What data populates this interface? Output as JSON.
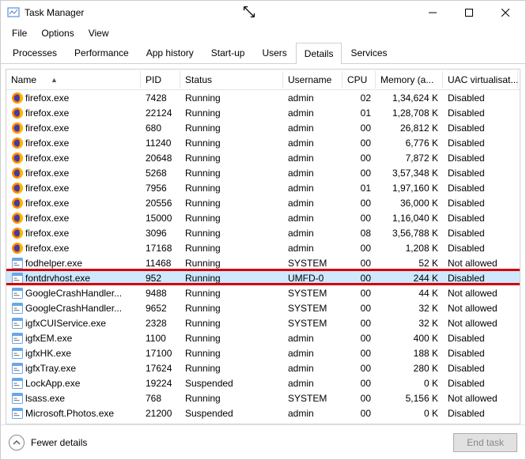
{
  "window": {
    "title": "Task Manager"
  },
  "menu": {
    "file": "File",
    "options": "Options",
    "view": "View"
  },
  "tabs": {
    "processes": "Processes",
    "performance": "Performance",
    "app_history": "App history",
    "startup": "Start-up",
    "users": "Users",
    "details": "Details",
    "services": "Services"
  },
  "columns": {
    "name": "Name",
    "pid": "PID",
    "status": "Status",
    "username": "Username",
    "cpu": "CPU",
    "memory": "Memory (a...",
    "uac": "UAC virtualisat..."
  },
  "footer": {
    "fewer": "Fewer details",
    "end": "End task"
  },
  "rows": [
    {
      "icon": "firefox",
      "name": "firefox.exe",
      "pid": "7428",
      "status": "Running",
      "user": "admin",
      "cpu": "02",
      "mem": "1,34,624 K",
      "uac": "Disabled"
    },
    {
      "icon": "firefox",
      "name": "firefox.exe",
      "pid": "22124",
      "status": "Running",
      "user": "admin",
      "cpu": "01",
      "mem": "1,28,708 K",
      "uac": "Disabled"
    },
    {
      "icon": "firefox",
      "name": "firefox.exe",
      "pid": "680",
      "status": "Running",
      "user": "admin",
      "cpu": "00",
      "mem": "26,812 K",
      "uac": "Disabled"
    },
    {
      "icon": "firefox",
      "name": "firefox.exe",
      "pid": "11240",
      "status": "Running",
      "user": "admin",
      "cpu": "00",
      "mem": "6,776 K",
      "uac": "Disabled"
    },
    {
      "icon": "firefox",
      "name": "firefox.exe",
      "pid": "20648",
      "status": "Running",
      "user": "admin",
      "cpu": "00",
      "mem": "7,872 K",
      "uac": "Disabled"
    },
    {
      "icon": "firefox",
      "name": "firefox.exe",
      "pid": "5268",
      "status": "Running",
      "user": "admin",
      "cpu": "00",
      "mem": "3,57,348 K",
      "uac": "Disabled"
    },
    {
      "icon": "firefox",
      "name": "firefox.exe",
      "pid": "7956",
      "status": "Running",
      "user": "admin",
      "cpu": "01",
      "mem": "1,97,160 K",
      "uac": "Disabled"
    },
    {
      "icon": "firefox",
      "name": "firefox.exe",
      "pid": "20556",
      "status": "Running",
      "user": "admin",
      "cpu": "00",
      "mem": "36,000 K",
      "uac": "Disabled"
    },
    {
      "icon": "firefox",
      "name": "firefox.exe",
      "pid": "15000",
      "status": "Running",
      "user": "admin",
      "cpu": "00",
      "mem": "1,16,040 K",
      "uac": "Disabled"
    },
    {
      "icon": "firefox",
      "name": "firefox.exe",
      "pid": "3096",
      "status": "Running",
      "user": "admin",
      "cpu": "08",
      "mem": "3,56,788 K",
      "uac": "Disabled"
    },
    {
      "icon": "firefox",
      "name": "firefox.exe",
      "pid": "17168",
      "status": "Running",
      "user": "admin",
      "cpu": "00",
      "mem": "1,208 K",
      "uac": "Disabled"
    },
    {
      "icon": "exe",
      "name": "fodhelper.exe",
      "pid": "11468",
      "status": "Running",
      "user": "SYSTEM",
      "cpu": "00",
      "mem": "52 K",
      "uac": "Not allowed"
    },
    {
      "icon": "exe",
      "name": "fontdrvhost.exe",
      "pid": "952",
      "status": "Running",
      "user": "UMFD-0",
      "cpu": "00",
      "mem": "244 K",
      "uac": "Disabled",
      "selected": true,
      "highlighted": true
    },
    {
      "icon": "exe",
      "name": "GoogleCrashHandler...",
      "pid": "9488",
      "status": "Running",
      "user": "SYSTEM",
      "cpu": "00",
      "mem": "44 K",
      "uac": "Not allowed"
    },
    {
      "icon": "exe",
      "name": "GoogleCrashHandler...",
      "pid": "9652",
      "status": "Running",
      "user": "SYSTEM",
      "cpu": "00",
      "mem": "32 K",
      "uac": "Not allowed"
    },
    {
      "icon": "exe",
      "name": "igfxCUIService.exe",
      "pid": "2328",
      "status": "Running",
      "user": "SYSTEM",
      "cpu": "00",
      "mem": "32 K",
      "uac": "Not allowed"
    },
    {
      "icon": "exe",
      "name": "igfxEM.exe",
      "pid": "1100",
      "status": "Running",
      "user": "admin",
      "cpu": "00",
      "mem": "400 K",
      "uac": "Disabled"
    },
    {
      "icon": "exe",
      "name": "igfxHK.exe",
      "pid": "17100",
      "status": "Running",
      "user": "admin",
      "cpu": "00",
      "mem": "188 K",
      "uac": "Disabled"
    },
    {
      "icon": "exe",
      "name": "igfxTray.exe",
      "pid": "17624",
      "status": "Running",
      "user": "admin",
      "cpu": "00",
      "mem": "280 K",
      "uac": "Disabled"
    },
    {
      "icon": "exe",
      "name": "LockApp.exe",
      "pid": "19224",
      "status": "Suspended",
      "user": "admin",
      "cpu": "00",
      "mem": "0 K",
      "uac": "Disabled"
    },
    {
      "icon": "exe",
      "name": "lsass.exe",
      "pid": "768",
      "status": "Running",
      "user": "SYSTEM",
      "cpu": "00",
      "mem": "5,156 K",
      "uac": "Not allowed"
    },
    {
      "icon": "exe",
      "name": "Microsoft.Photos.exe",
      "pid": "21200",
      "status": "Suspended",
      "user": "admin",
      "cpu": "00",
      "mem": "0 K",
      "uac": "Disabled"
    }
  ]
}
